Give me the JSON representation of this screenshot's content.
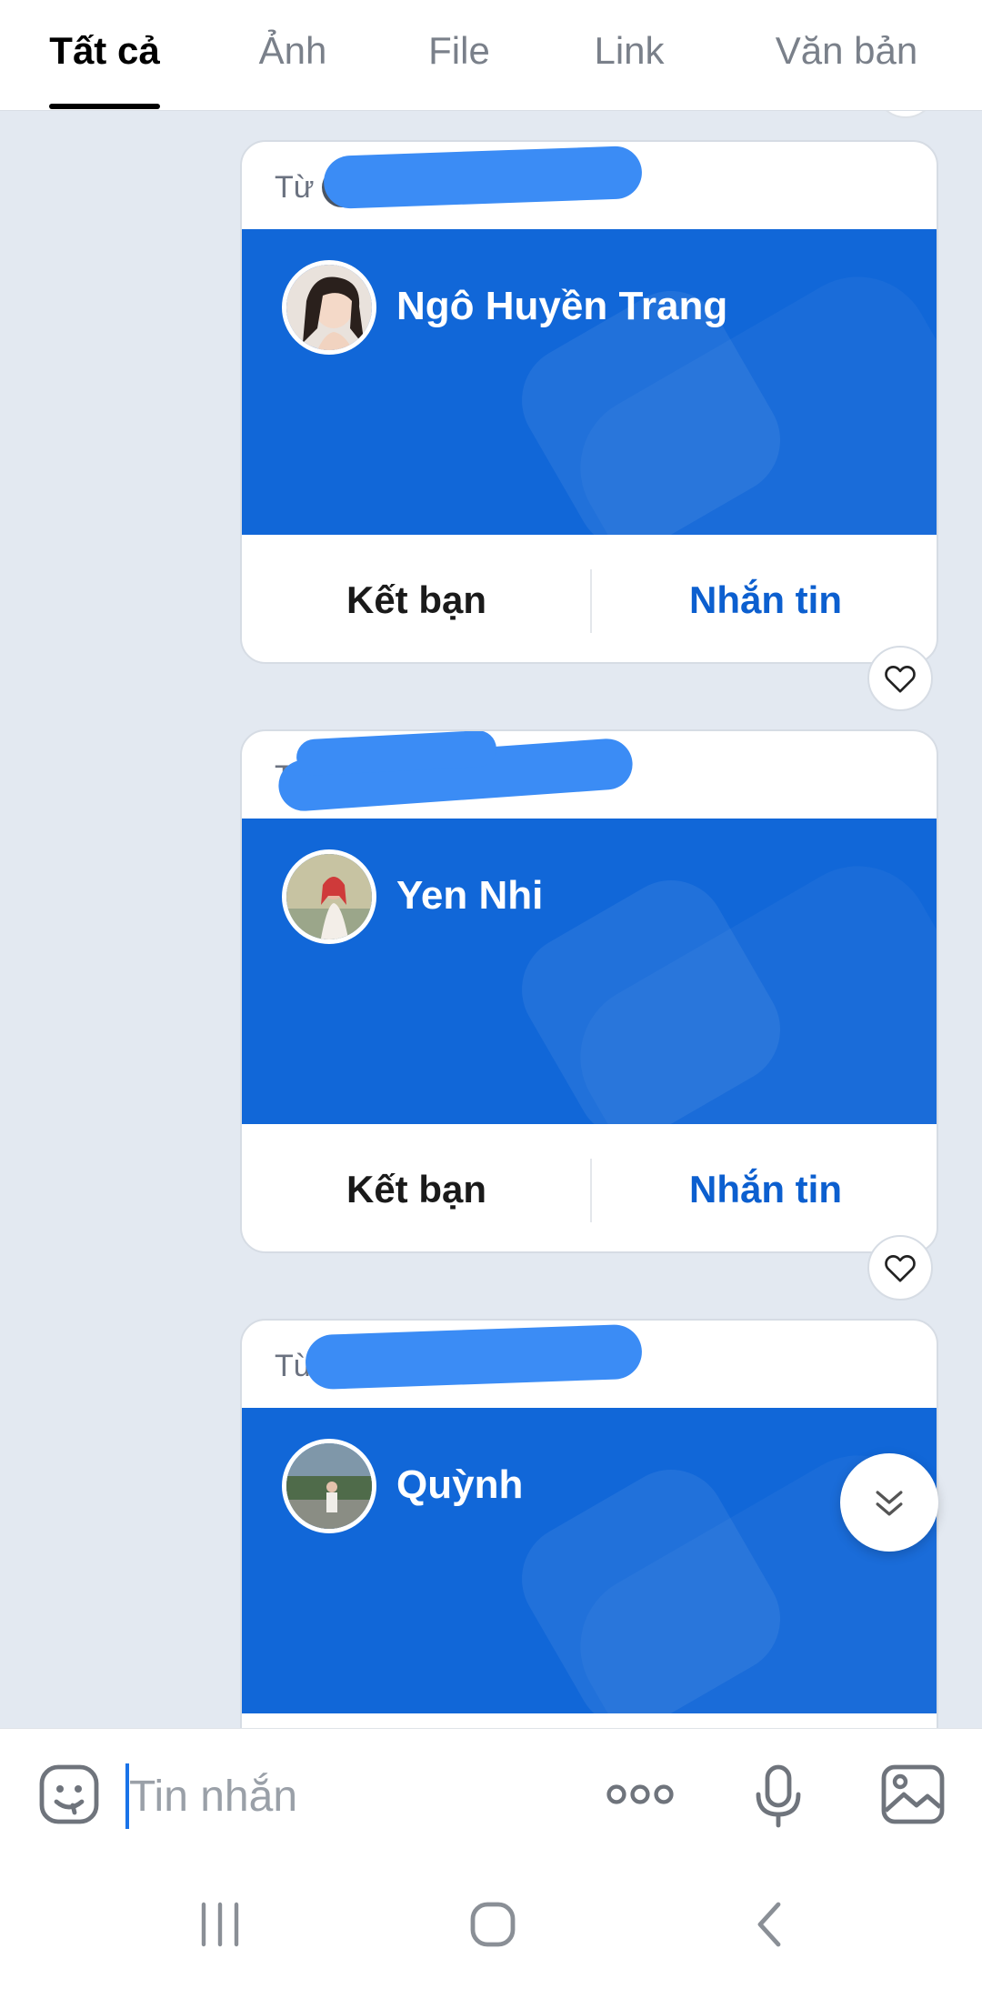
{
  "tabs": [
    {
      "label": "Tất cả",
      "active": true
    },
    {
      "label": "Ảnh",
      "active": false
    },
    {
      "label": "File",
      "active": false
    },
    {
      "label": "Link",
      "active": false
    },
    {
      "label": "Văn bản",
      "active": false
    }
  ],
  "cards": [
    {
      "from_label": "Từ",
      "name": "Ngô Huyền Trang",
      "add_friend": "Kết bạn",
      "message": "Nhắn tin"
    },
    {
      "from_label": "Từ",
      "name": "Yen Nhi",
      "add_friend": "Kết bạn",
      "message": "Nhắn tin"
    },
    {
      "from_label": "Từ",
      "name": "Quỳnh"
    }
  ],
  "composer": {
    "placeholder": "Tin nhắn"
  },
  "colors": {
    "banner": "#1167d8",
    "link_blue": "#0c5fcf",
    "redaction": "#3b8cf5",
    "background": "#e3e9f1"
  },
  "icons": [
    "sticker-icon",
    "more-icon",
    "microphone-icon",
    "image-icon",
    "heart-icon",
    "chevron-double-down-icon",
    "recent-apps-icon",
    "home-icon",
    "back-icon"
  ]
}
